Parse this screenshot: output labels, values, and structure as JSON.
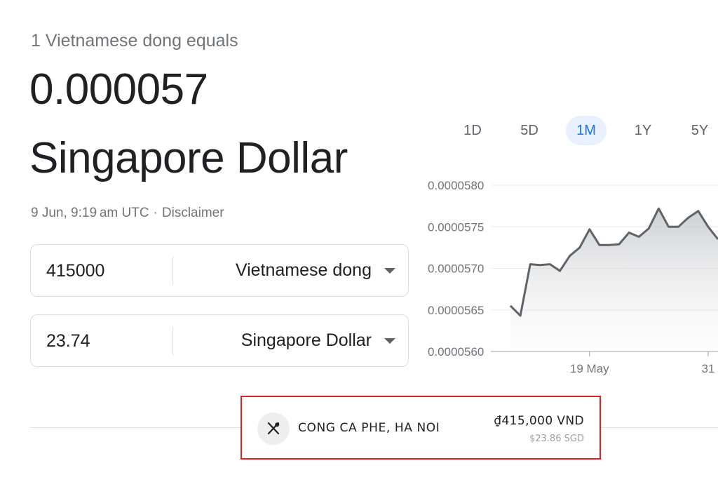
{
  "header": {
    "intro": "1 Vietnamese dong equals",
    "rate": "0.000057",
    "target_currency": "Singapore Dollar",
    "timestamp": "9 Jun, 9:19 am UTC",
    "separator": "·",
    "disclaimer": "Disclaimer"
  },
  "converter": {
    "from": {
      "value": "415000",
      "currency": "Vietnamese dong"
    },
    "to": {
      "value": "23.74",
      "currency": "Singapore Dollar"
    }
  },
  "range_tabs": [
    {
      "label": "1D",
      "active": false
    },
    {
      "label": "5D",
      "active": false
    },
    {
      "label": "1M",
      "active": true
    },
    {
      "label": "1Y",
      "active": false
    },
    {
      "label": "5Y",
      "active": false
    }
  ],
  "chart_data": {
    "type": "area",
    "ylim": [
      5.6e-05,
      5.8e-05
    ],
    "yticks": [
      "0.0000580",
      "0.0000575",
      "0.0000570",
      "0.0000565",
      "0.0000560"
    ],
    "ytick_values": [
      5.8e-05,
      5.75e-05,
      5.7e-05,
      5.65e-05,
      5.6e-05
    ],
    "xticks": [
      "19 May",
      "31"
    ],
    "x": [
      "11 May",
      "12 May",
      "13 May",
      "14 May",
      "15 May",
      "16 May",
      "17 May",
      "18 May",
      "19 May",
      "20 May",
      "21 May",
      "22 May",
      "23 May",
      "24 May",
      "25 May",
      "26 May",
      "27 May",
      "28 May",
      "29 May",
      "30 May",
      "31 May",
      "1 Jun"
    ],
    "values": [
      5.655e-05,
      5.643e-05,
      5.705e-05,
      5.704e-05,
      5.705e-05,
      5.697e-05,
      5.715e-05,
      5.725e-05,
      5.747e-05,
      5.728e-05,
      5.728e-05,
      5.729e-05,
      5.743e-05,
      5.738e-05,
      5.748e-05,
      5.772e-05,
      5.75e-05,
      5.75e-05,
      5.761e-05,
      5.769e-05,
      5.75e-05,
      5.735e-05
    ],
    "line_color": "#5f6368",
    "grid": true
  },
  "receipt": {
    "merchant": "CONG CA PHE, HA NOI",
    "amount_local": "₫415,000 VND",
    "amount_converted": "$23.86 SGD",
    "icon": "fork-knife-icon"
  },
  "colors": {
    "accent": "#1a73e8",
    "active_tab_bg": "#e8f0fe",
    "highlight_border": "#e02020"
  }
}
